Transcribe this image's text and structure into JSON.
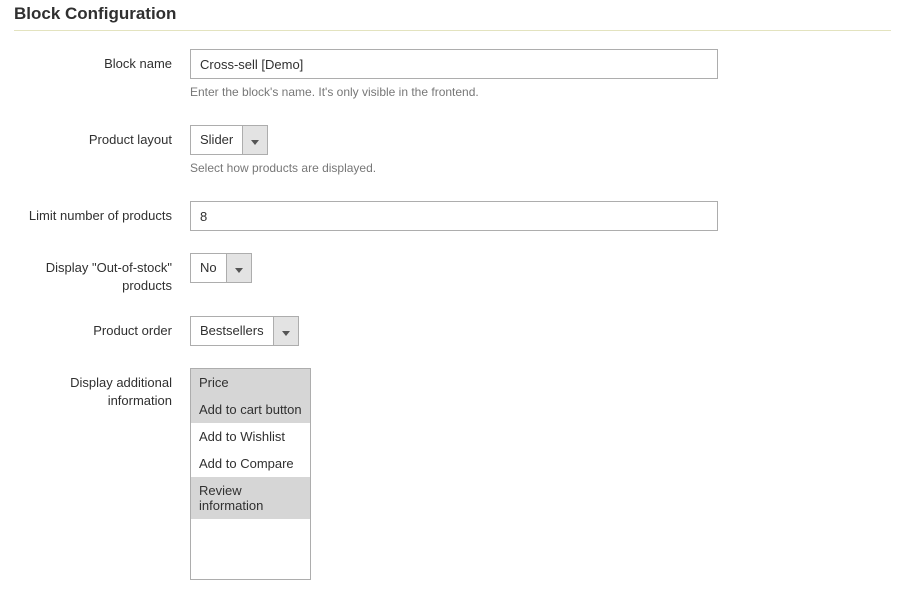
{
  "section_title": "Block Configuration",
  "fields": {
    "block_name": {
      "label": "Block name",
      "value": "Cross-sell [Demo]",
      "hint": "Enter the block's name. It's only visible in the frontend."
    },
    "product_layout": {
      "label": "Product layout",
      "value": "Slider",
      "hint": "Select how products are displayed."
    },
    "limit_products": {
      "label": "Limit number of products",
      "value": "8"
    },
    "out_of_stock": {
      "label": "Display \"Out-of-stock\" products",
      "value": "No"
    },
    "product_order": {
      "label": "Product order",
      "value": "Bestsellers"
    },
    "additional_info": {
      "label": "Display additional information",
      "options": [
        {
          "label": "Price",
          "selected": true
        },
        {
          "label": "Add to cart button",
          "selected": true
        },
        {
          "label": "Add to Wishlist",
          "selected": false
        },
        {
          "label": "Add to Compare",
          "selected": false
        },
        {
          "label": "Review information",
          "selected": true
        }
      ]
    }
  }
}
